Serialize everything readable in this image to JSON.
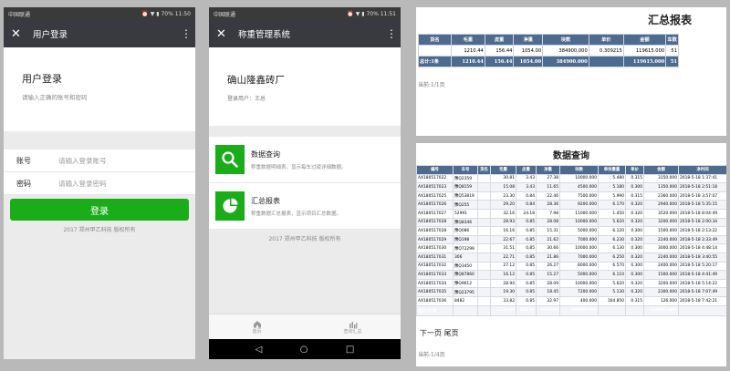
{
  "status": {
    "carrier": "中国联通",
    "icons": "⏰ ▼ ▮",
    "battery": "70%",
    "time1": "11:50",
    "time2": "11:51"
  },
  "login": {
    "titlebar": "用户登录",
    "heading": "用户登录",
    "subheading": "请输入正确的账号和密码",
    "account_label": "账号",
    "account_placeholder": "请输入登录账号",
    "password_label": "密码",
    "password_placeholder": "请输入登录密码",
    "login_button": "登录",
    "copyright": "2017 郑州甲乙科技 版权所有"
  },
  "home": {
    "titlebar": "称重管理系统",
    "org_name": "确山隆鑫砖厂",
    "login_user": "登录用户：王总",
    "menu": [
      {
        "title": "数据查询",
        "desc": "称重数据明细表，显示每车过磅详细数据。",
        "icon": "search-icon"
      },
      {
        "title": "汇总报表",
        "desc": "称重数据汇总报表，显示项目汇总数据。",
        "icon": "pie-chart-icon"
      }
    ],
    "copyright": "2017 郑州甲乙科技 版权所有",
    "tabs": [
      {
        "label": "首页",
        "icon": "home-icon"
      },
      {
        "label": "查询汇总",
        "icon": "bar-chart-icon"
      }
    ],
    "nav_icons": [
      "back-icon",
      "home-circle-icon",
      "recents-icon"
    ]
  },
  "summary": {
    "title": "汇总报表",
    "columns": [
      "货名",
      "毛重",
      "皮重",
      "净重",
      "块数",
      "单价",
      "金额",
      "车数"
    ],
    "rows": [
      [
        "",
        "1210.44",
        "156.44",
        "1054.00",
        "384900.000",
        "0.309215",
        "119615.000",
        "51"
      ]
    ],
    "total": [
      "总计:1条",
      "1210.44",
      "156.44",
      "1054.00",
      "384900.000",
      "",
      "119615.000",
      "51"
    ],
    "pager_info": "当前:1/1页"
  },
  "query": {
    "title": "数据查询",
    "columns": [
      "编号",
      "车号",
      "货名",
      "毛重",
      "皮重",
      "净重",
      "块数",
      "单块重量",
      "单价",
      "金额",
      "净时间"
    ],
    "rows": [
      [
        "AX180517022",
        "豫Q2359",
        "",
        "30.81",
        "3.43",
        "27.38",
        "10000.000",
        "5.480",
        "0.315",
        "3150.000",
        "2018-5-18 1:37:41"
      ],
      [
        "AX180517023",
        "豫Q8159",
        "",
        "15.08",
        "3.43",
        "11.65",
        "4500.000",
        "5.180",
        "0.300",
        "1350.000",
        "2018-5-18 2:51:18"
      ],
      [
        "AX180517025",
        "豫Q53819",
        "",
        "23.30",
        "0.84",
        "22.46",
        "7500.000",
        "5.990",
        "0.315",
        "2360.000",
        "2018-5-18 3:57:07"
      ],
      [
        "AX180517026",
        "豫Q255",
        "",
        "29.20",
        "0.84",
        "28.36",
        "9200.000",
        "6.170",
        "0.320",
        "2940.000",
        "2018-5-18 5:35:15"
      ],
      [
        "AX180517027",
        "52991",
        "",
        "32.16",
        "24.18",
        "7.98",
        "11000.000",
        "1.450",
        "0.320",
        "3520.000",
        "2018-5-18 8:04:49"
      ],
      [
        "AX180517028",
        "豫Q8346",
        "",
        "28.93",
        "0.85",
        "28.08",
        "10000.000",
        "5.620",
        "0.320",
        "3200.000",
        "2018-5-18 2:00:34"
      ],
      [
        "AX180517028",
        "豫Q086",
        "",
        "16.16",
        "0.85",
        "15.31",
        "5000.000",
        "6.120",
        "0.300",
        "1500.000",
        "2018-5-18 2:13:22"
      ],
      [
        "AX180517029",
        "豫Q198",
        "",
        "22.67",
        "0.85",
        "21.62",
        "7000.000",
        "6.230",
        "0.320",
        "2240.000",
        "2018-5-18 2:33:49"
      ],
      [
        "AX180517030",
        "豫Q72299",
        "",
        "31.51",
        "0.85",
        "30.66",
        "10000.000",
        "6.130",
        "0.300",
        "3000.000",
        "2018-5-18 4:48:14"
      ],
      [
        "AX180517031",
        "306",
        "",
        "22.71",
        "0.85",
        "21.86",
        "7000.000",
        "6.250",
        "0.320",
        "2240.000",
        "2018-5-18 3:40:55"
      ],
      [
        "AX180517032",
        "豫Q3450",
        "",
        "27.12",
        "0.85",
        "26.27",
        "8000.000",
        "6.570",
        "0.300",
        "2400.000",
        "2018-5-18 5:20:17"
      ],
      [
        "AX180517033",
        "豫Q87860",
        "",
        "16.12",
        "0.85",
        "15.27",
        "5000.000",
        "6.110",
        "0.300",
        "1500.000",
        "2018-5-18 4:41:49"
      ],
      [
        "AX180517034",
        "豫Q9612",
        "",
        "28.94",
        "0.85",
        "28.09",
        "10000.000",
        "5.620",
        "0.320",
        "3200.000",
        "2018-5-18 5:14:22"
      ],
      [
        "AX180517035",
        "豫Q23795",
        "",
        "19.30",
        "0.85",
        "18.45",
        "7200.000",
        "5.130",
        "0.320",
        "2300.000",
        "2018-5-18 7:07:49"
      ],
      [
        "AX180517036",
        "8482",
        "",
        "33.82",
        "0.85",
        "32.97",
        "400.000",
        "164.850",
        "0.315",
        "126.000",
        "2018-5-18 7:42:21"
      ]
    ],
    "total": [
      "总计:51条",
      "",
      "",
      "1210.44",
      "156.44",
      "1054.00",
      "384900.000",
      "",
      "",
      "119615.000",
      ""
    ],
    "pager_links": "下一页 尾页",
    "pager_info": "当前:1/4页"
  }
}
